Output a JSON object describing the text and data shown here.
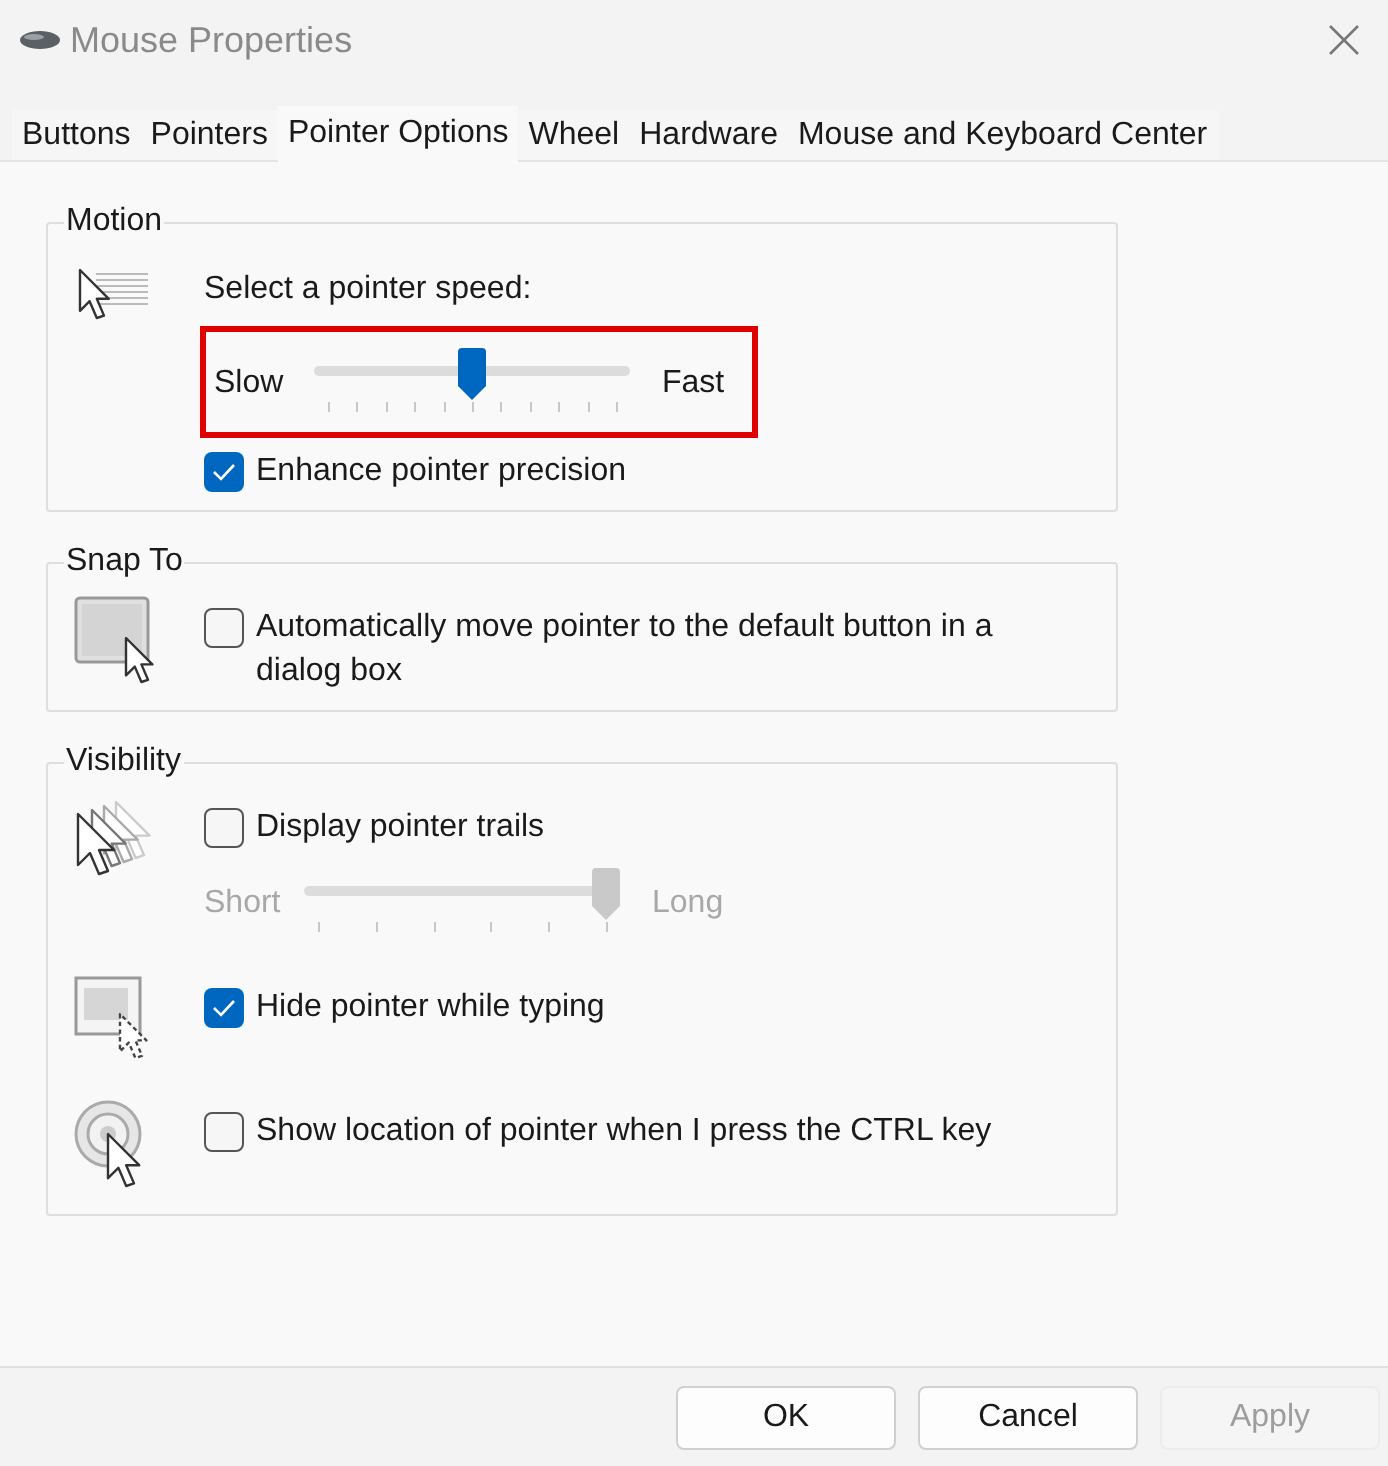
{
  "window": {
    "title": "Mouse Properties"
  },
  "tabs": [
    {
      "label": "Buttons",
      "selected": false
    },
    {
      "label": "Pointers",
      "selected": false
    },
    {
      "label": "Pointer Options",
      "selected": true
    },
    {
      "label": "Wheel",
      "selected": false
    },
    {
      "label": "Hardware",
      "selected": false
    },
    {
      "label": "Mouse and Keyboard Center",
      "selected": false
    }
  ],
  "groups": [
    {
      "title": "Motion",
      "rows": [
        {
          "kind": "speed",
          "controls": [
            {
              "kind": "label",
              "text": "Select a pointer speed:"
            },
            {
              "kind": "slider",
              "min_label": "Slow",
              "max_label": "Fast",
              "level": 0.5,
              "disabled": false,
              "highlighted": true
            },
            {
              "kind": "checkbox",
              "label": "Enhance pointer precision",
              "checked": true
            }
          ]
        }
      ]
    },
    {
      "title": "Snap To",
      "rows": [
        {
          "kind": "snap",
          "controls": [
            {
              "kind": "checkbox",
              "label": "Automatically move pointer to the default button in a dialog box",
              "checked": false
            }
          ]
        }
      ]
    },
    {
      "title": "Visibility",
      "rows": [
        {
          "kind": "trails",
          "controls": [
            {
              "kind": "checkbox",
              "label": "Display pointer trails",
              "checked": false
            },
            {
              "kind": "slider",
              "min_label": "Short",
              "max_label": "Long",
              "level": 1,
              "disabled": true,
              "highlighted": false
            }
          ]
        },
        {
          "kind": "hide",
          "controls": [
            {
              "kind": "checkbox",
              "label": "Hide pointer while typing",
              "checked": true
            }
          ]
        },
        {
          "kind": "locate",
          "controls": [
            {
              "kind": "checkbox",
              "label": "Show location of pointer when I press the CTRL key",
              "checked": false
            }
          ]
        }
      ]
    }
  ],
  "buttons": [
    {
      "label": "OK",
      "disabled": false
    },
    {
      "label": "Cancel",
      "disabled": false
    },
    {
      "label": "Apply",
      "disabled": true
    }
  ]
}
